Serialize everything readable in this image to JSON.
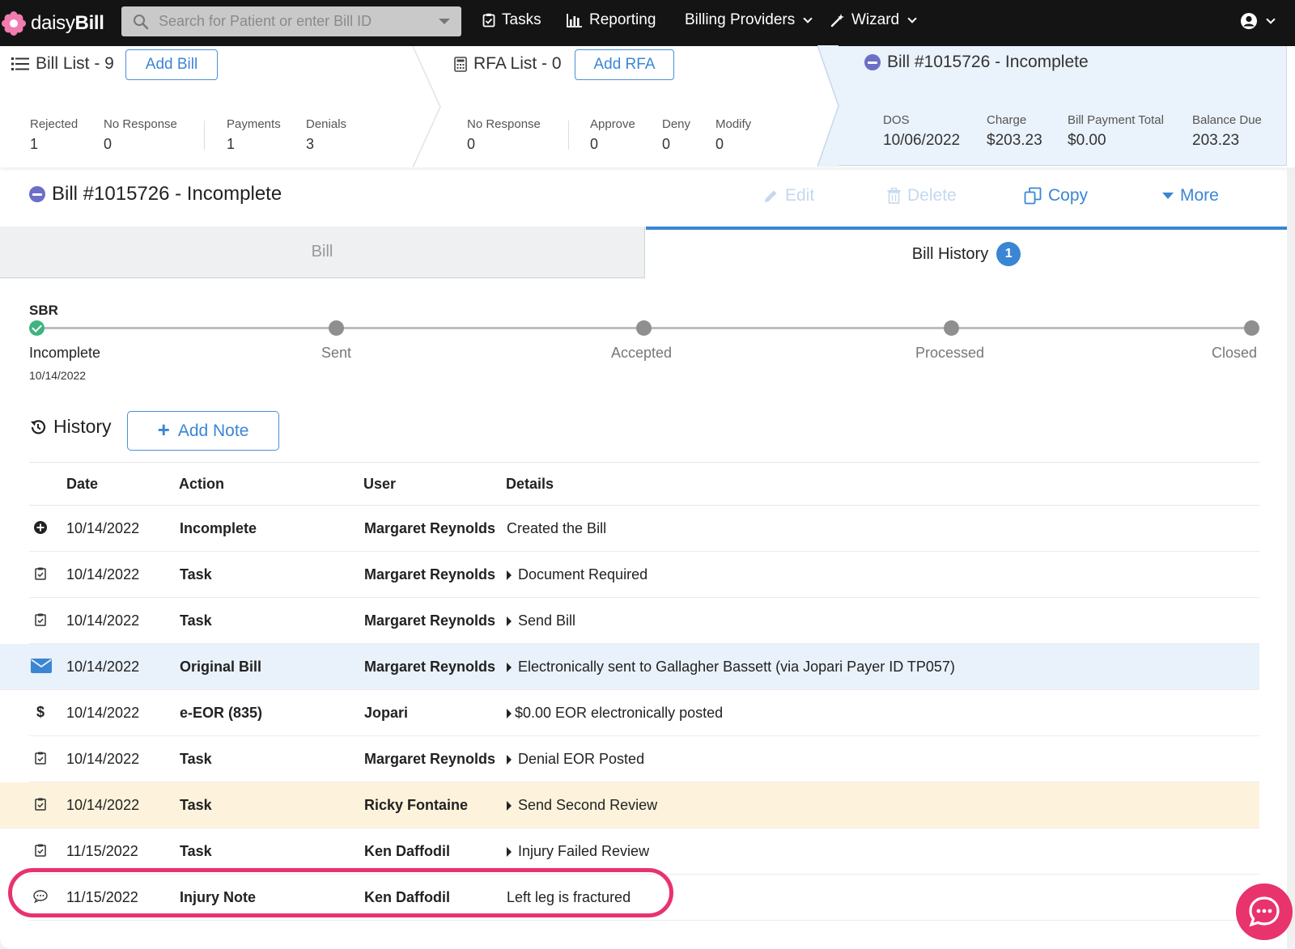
{
  "app": {
    "brand_light": "daisy",
    "brand_bold": "Bill"
  },
  "search": {
    "placeholder": "Search for Patient or enter Bill ID"
  },
  "nav": {
    "tasks": "Tasks",
    "reporting": "Reporting",
    "billing_providers": "Billing Providers",
    "wizard": "Wizard"
  },
  "summary": {
    "bill_list": {
      "title": "Bill List - 9",
      "add_label": "Add Bill",
      "stats": [
        {
          "label": "Rejected",
          "value": "1"
        },
        {
          "label": "No Response",
          "value": "0"
        },
        {
          "label": "Payments",
          "value": "1"
        },
        {
          "label": "Denials",
          "value": "3"
        }
      ]
    },
    "rfa_list": {
      "title": "RFA List - 0",
      "add_label": "Add RFA",
      "stats": [
        {
          "label": "No Response",
          "value": "0"
        },
        {
          "label": "Approve",
          "value": "0"
        },
        {
          "label": "Deny",
          "value": "0"
        },
        {
          "label": "Modify",
          "value": "0"
        }
      ]
    },
    "current_bill": {
      "title": "Bill #1015726 - Incomplete",
      "stats": [
        {
          "label": "DOS",
          "value": "10/06/2022"
        },
        {
          "label": "Charge",
          "value": "$203.23"
        },
        {
          "label": "Bill Payment Total",
          "value": "$0.00"
        },
        {
          "label": "Balance Due",
          "value": "203.23"
        }
      ]
    }
  },
  "bill": {
    "title": "Bill #1015726 - Incomplete",
    "actions": {
      "edit": "Edit",
      "delete": "Delete",
      "copy": "Copy",
      "more": "More"
    }
  },
  "tabs": {
    "bill": "Bill",
    "history": "Bill History",
    "history_count": "1"
  },
  "progress": {
    "label": "SBR",
    "stages": [
      "Incomplete",
      "Sent",
      "Accepted",
      "Processed",
      "Closed"
    ],
    "current_date": "10/14/2022"
  },
  "history": {
    "title": "History",
    "add_note": "Add Note",
    "columns": {
      "date": "Date",
      "action": "Action",
      "user": "User",
      "details": "Details"
    },
    "rows": [
      {
        "icon": "plus-circle-icon",
        "date": "10/14/2022",
        "action": "Incomplete",
        "user": "Margaret Reynolds",
        "details": "Created the Bill",
        "expand": false
      },
      {
        "icon": "task-icon",
        "date": "10/14/2022",
        "action": "Task",
        "user": "Margaret Reynolds",
        "details": "Document Required",
        "expand": true
      },
      {
        "icon": "task-icon",
        "date": "10/14/2022",
        "action": "Task",
        "user": "Margaret Reynolds",
        "details": "Send Bill",
        "expand": true
      },
      {
        "icon": "envelope-icon",
        "date": "10/14/2022",
        "action": "Original Bill",
        "user": "Margaret Reynolds",
        "details": "Electronically sent to Gallagher Bassett (via Jopari Payer ID TP057)",
        "expand": true
      },
      {
        "icon": "dollar-icon",
        "date": "10/14/2022",
        "action": "e-EOR (835)",
        "user": "Jopari",
        "details": "$0.00 EOR electronically posted",
        "expand": true
      },
      {
        "icon": "task-icon",
        "date": "10/14/2022",
        "action": "Task",
        "user": "Margaret Reynolds",
        "details": "Denial EOR Posted",
        "expand": true
      },
      {
        "icon": "task-icon",
        "date": "10/14/2022",
        "action": "Task",
        "user": "Ricky Fontaine",
        "details": "Send Second Review",
        "expand": true
      },
      {
        "icon": "task-icon",
        "date": "11/15/2022",
        "action": "Task",
        "user": "Ken Daffodil",
        "details": "Injury Failed Review",
        "expand": true
      },
      {
        "icon": "comment-icon",
        "date": "11/15/2022",
        "action": "Injury Note",
        "user": "Ken Daffodil",
        "details": "Left leg is fractured",
        "expand": false
      }
    ]
  },
  "colors": {
    "accent": "#3a86d4",
    "highlight": "#e8336d",
    "success": "#3fb37f",
    "nav_bg": "#141414"
  }
}
